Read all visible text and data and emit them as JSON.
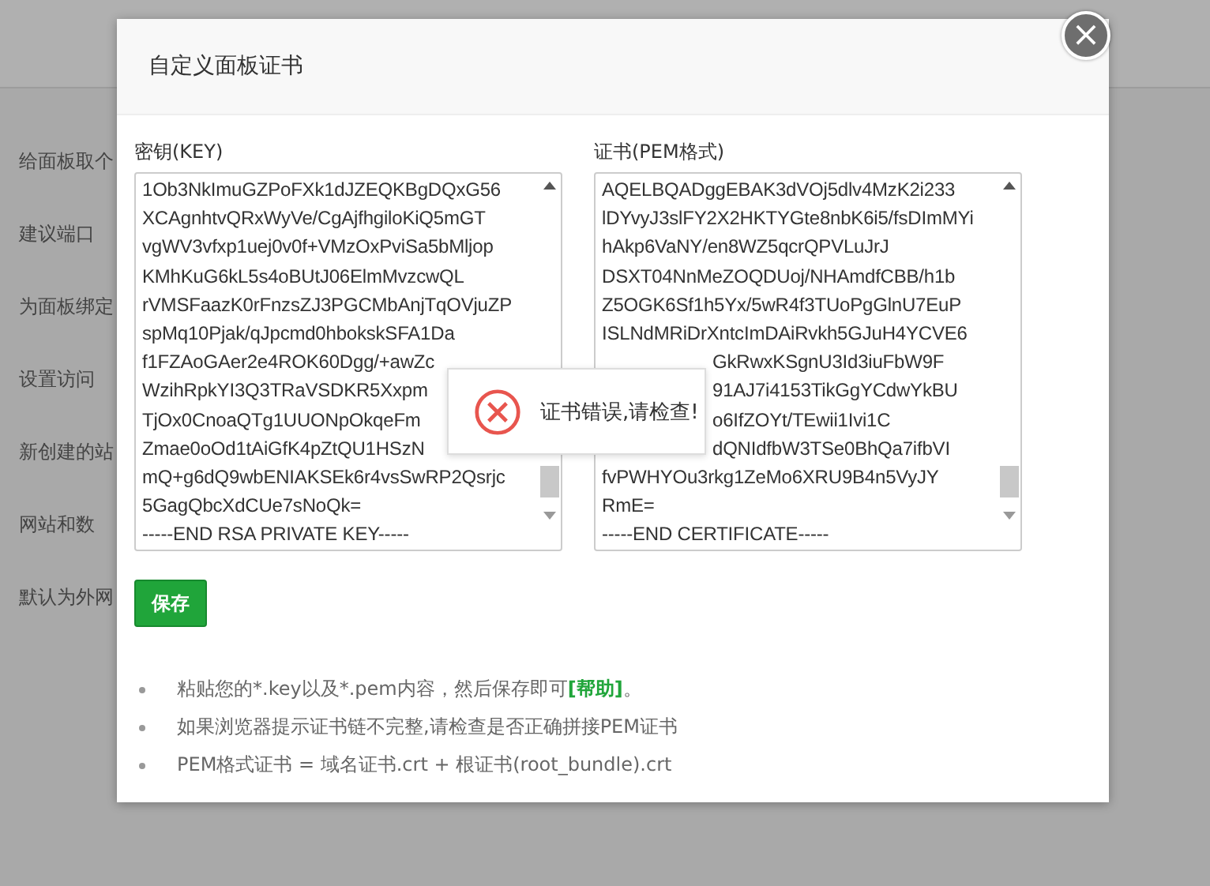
{
  "background": {
    "items": [
      "给面板取个",
      "建议端口",
      "为面板绑定",
      "设置访问",
      "新创建的站",
      "网站和数",
      "默认为外网"
    ]
  },
  "dialog": {
    "title": "自定义面板证书",
    "close": "×",
    "key": {
      "label": "密钥(KEY)",
      "lines": [
        {
          "text": "1Ob3NkImuGZPoFXk1dJZEQKBgDQxG56",
          "kind": "full"
        },
        {
          "text": "XCAgnhtvQRxWyVe/CgAjfhgiloKiQ5mGT",
          "kind": "full"
        },
        {
          "text": "vgWV3vfxp1uej0v0f+VMzOxPviSa5bMljop",
          "kind": "full"
        },
        {
          "text": "KMhKuG6kL5s4oBUtJ06ElmMvzcwQL",
          "kind": "full"
        },
        {
          "text": "rVMSFaazK0rFnzsZJ3PGCMbAnjTqOVjuZP",
          "kind": "full"
        },
        {
          "text": "spMq10Pjak/qJpcmd0hbokskSFA1Da",
          "kind": "full"
        },
        {
          "text": "f1FZAoGAer2e4ROK60Dgg/+awZc",
          "kind": "full"
        },
        {
          "text": "WzihRpkYI3Q3TRaVSDKR5Xxpm",
          "kind": "full"
        },
        {
          "text": "TjOx0CnoaQTg1UUONpOkqeFm",
          "kind": "full"
        },
        {
          "text": "Zmae0oOd1tAiGfK4pZtQU1HSzN",
          "kind": "full"
        },
        {
          "text": "mQ+g6dQ9wbENIAKSEk6r4vsSwRP2Qsrjc",
          "kind": "full"
        },
        {
          "text": "5GagQbcXdCUe7sNoQk=",
          "kind": "full"
        },
        {
          "text": "-----END RSA PRIVATE KEY-----",
          "kind": "full"
        }
      ]
    },
    "cert": {
      "label": "证书(PEM格式)",
      "lines": [
        {
          "text": "AQELBQADggEBAK3dVOj5dlv4MzK2i233",
          "kind": "full"
        },
        {
          "text": "lDYvyJ3slFY2X2HKTYGte8nbK6i5/fsDImMYi",
          "kind": "full"
        },
        {
          "text": "hAkp6VaNY/en8WZ5qcrQPVLuJrJ",
          "kind": "full"
        },
        {
          "text": "DSXT04NnMeZOQDUoj/NHAmdfCBB/h1b",
          "kind": "full"
        },
        {
          "text": "Z5OGK6Sf1h5Yx/5wR4f3TUoPgGlnU7EuP",
          "kind": "full"
        },
        {
          "text": "ISLNdMRiDrXntcImDAiRvkh5GJuH4YCVE6",
          "kind": "full"
        },
        {
          "text": "GkRwxKSgnU3Id3iuFbW9F",
          "kind": "tail"
        },
        {
          "text": "91AJ7i4153TikGgYCdwYkBU",
          "kind": "tail"
        },
        {
          "text": "o6IfZOYt/TEwii1Ivi1C",
          "kind": "tail"
        },
        {
          "text": "dQNIdfbW3TSe0BhQa7ifbVI",
          "kind": "tail"
        },
        {
          "text": "fvPWHYOu3rkg1ZeMo6XRU9B4n5VyJY",
          "kind": "full"
        },
        {
          "text": "RmE=",
          "kind": "full"
        },
        {
          "text": "-----END CERTIFICATE-----",
          "kind": "full"
        }
      ]
    },
    "save": "保存",
    "tips": [
      {
        "text": "粘贴您的*.key以及*.pem内容，然后保存即可",
        "link": "[帮助]",
        "tail": "。"
      },
      {
        "text": "如果浏览器提示证书链不完整,请检查是否正确拼接PEM证书"
      },
      {
        "text": "PEM格式证书 = 域名证书.crt + 根证书(root_bundle).crt"
      }
    ]
  },
  "toast": {
    "message": "证书错误,请检查!"
  }
}
